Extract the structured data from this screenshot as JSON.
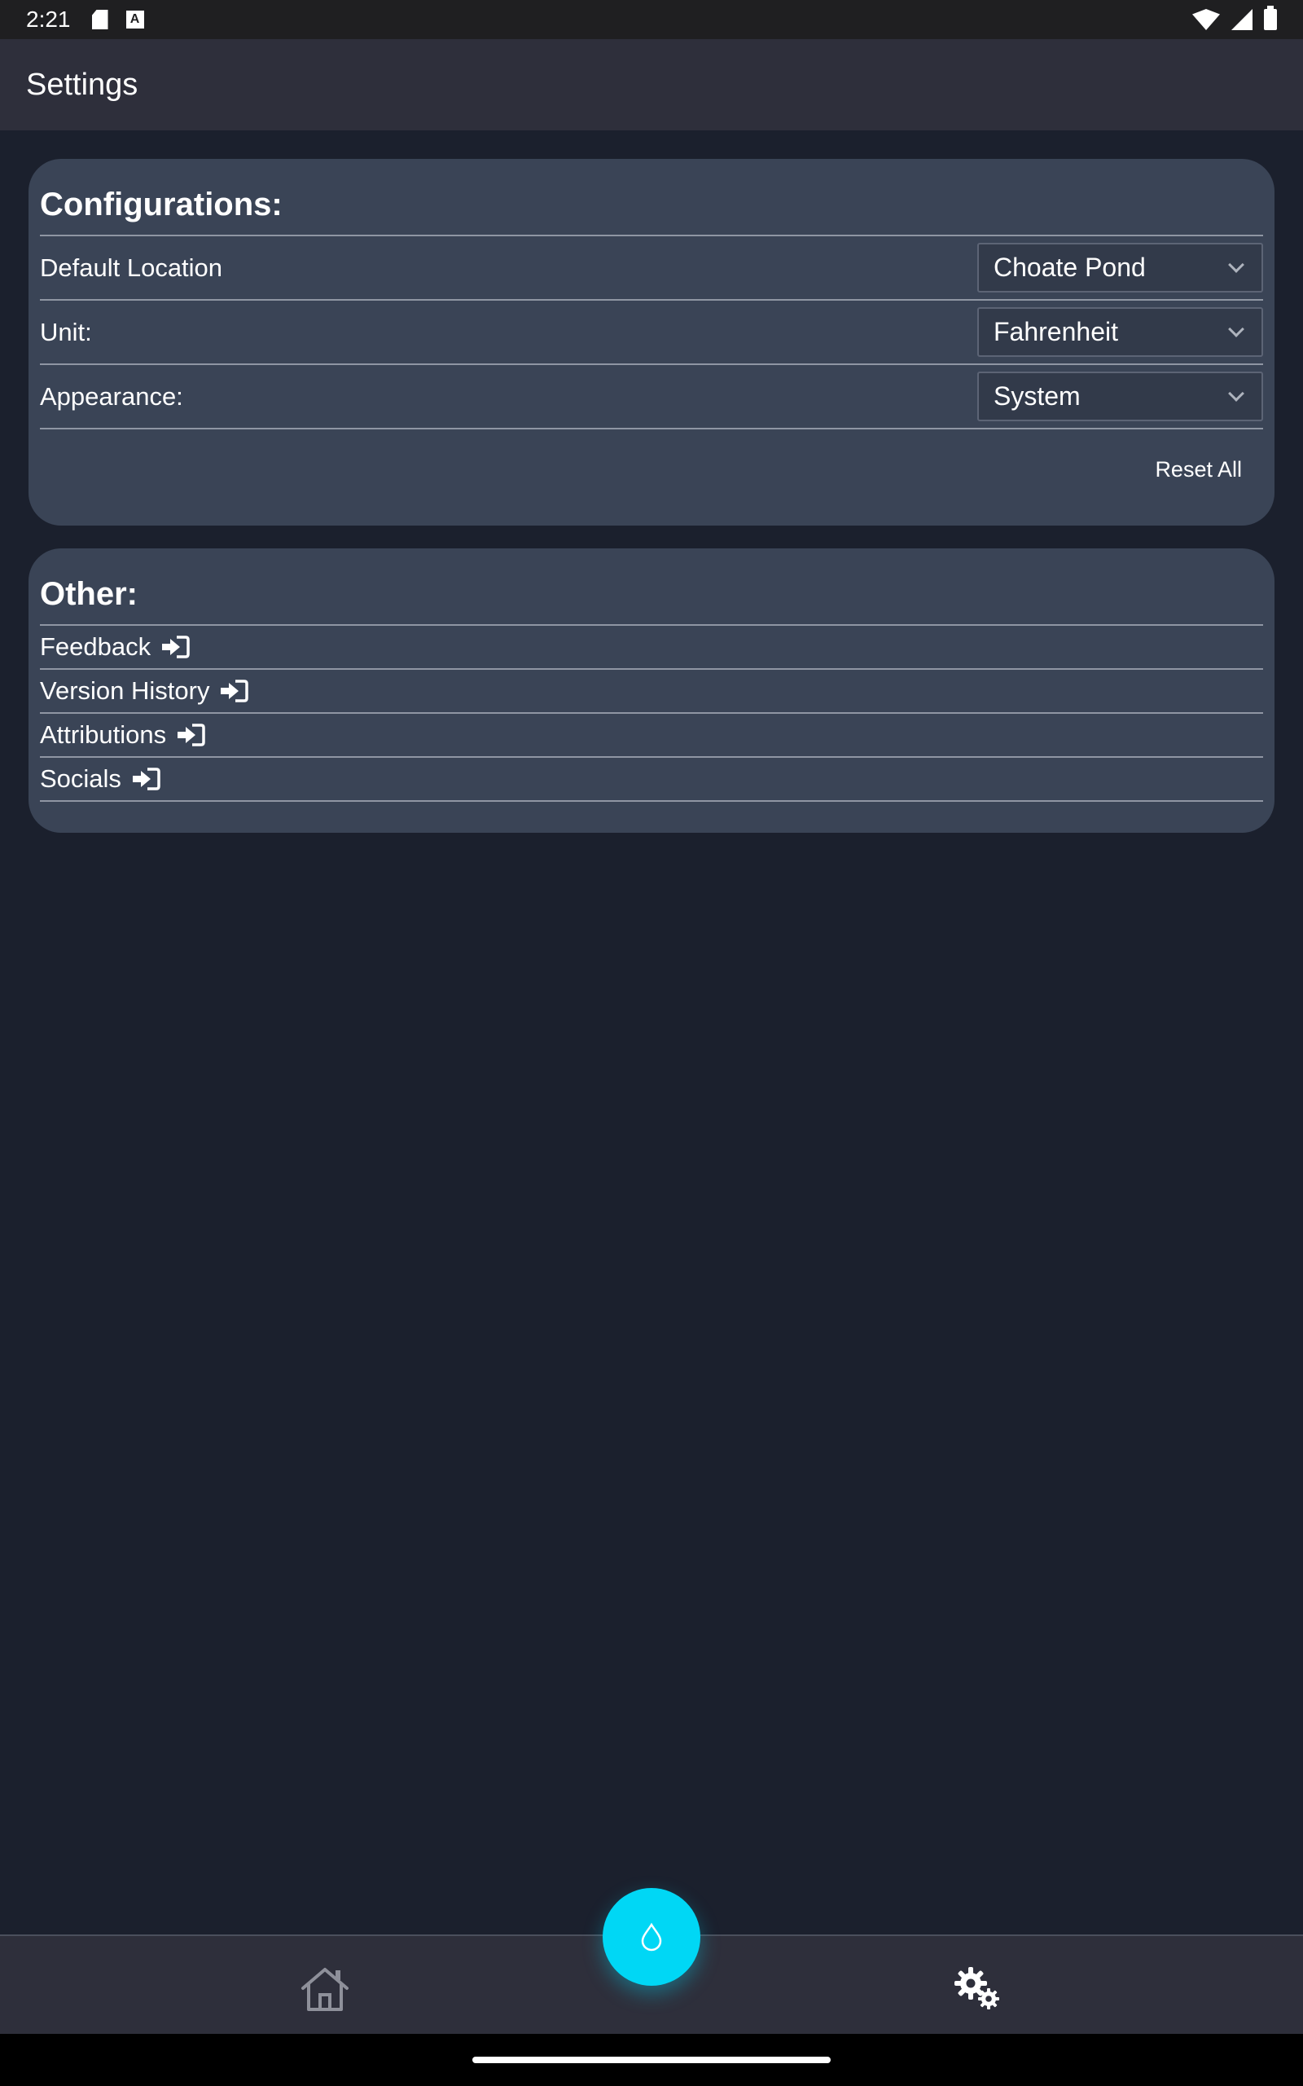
{
  "status_bar": {
    "time": "2:21",
    "icons": [
      "sd-card-icon",
      "a-notification-icon",
      "wifi-icon",
      "signal-icon",
      "battery-icon"
    ]
  },
  "app_bar": {
    "title": "Settings"
  },
  "configurations": {
    "heading": "Configurations:",
    "rows": [
      {
        "label": "Default Location",
        "value": "Choate Pond"
      },
      {
        "label": "Unit:",
        "value": "Fahrenheit"
      },
      {
        "label": "Appearance:",
        "value": "System"
      }
    ],
    "reset_label": "Reset All"
  },
  "other": {
    "heading": "Other:",
    "items": [
      {
        "label": "Feedback",
        "icon": "login-icon"
      },
      {
        "label": "Version History",
        "icon": "login-icon"
      },
      {
        "label": "Attributions",
        "icon": "login-icon"
      },
      {
        "label": "Socials",
        "icon": "login-icon"
      }
    ]
  },
  "bottom_nav": {
    "items": [
      "home-icon",
      "water-drop-icon",
      "gears-icon"
    ],
    "fab_color": "#00d7f5"
  },
  "colors": {
    "background": "#1b202d",
    "card": "#3a4456",
    "app_bar": "#2e2f3b",
    "accent": "#00d7f5"
  }
}
